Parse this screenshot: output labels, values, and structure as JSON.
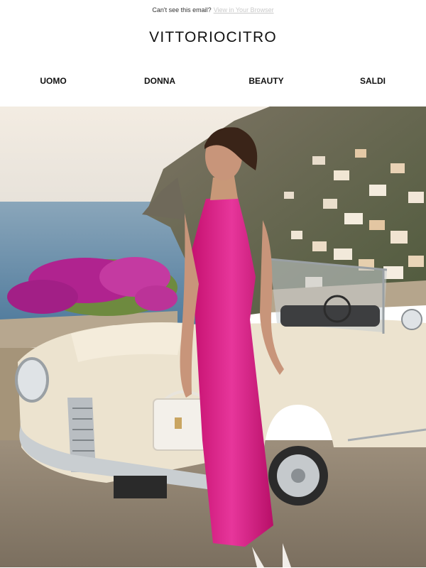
{
  "preheader": {
    "text": "Can't see this email?",
    "link": "View in Your Browser"
  },
  "brand": {
    "logo": "VITTORIOCITRO"
  },
  "nav": {
    "items": [
      "UOMO",
      "DONNA",
      "BEAUTY",
      "SALDI"
    ]
  },
  "hero": {
    "subject": "woman-in-pink-slip-dress-with-vintage-convertible",
    "colors": {
      "dress": "#e0218a",
      "car": "#ece3cf",
      "sea": "#5f89a8",
      "sky": "#f2ece3",
      "flowers": "#b0238f"
    }
  }
}
